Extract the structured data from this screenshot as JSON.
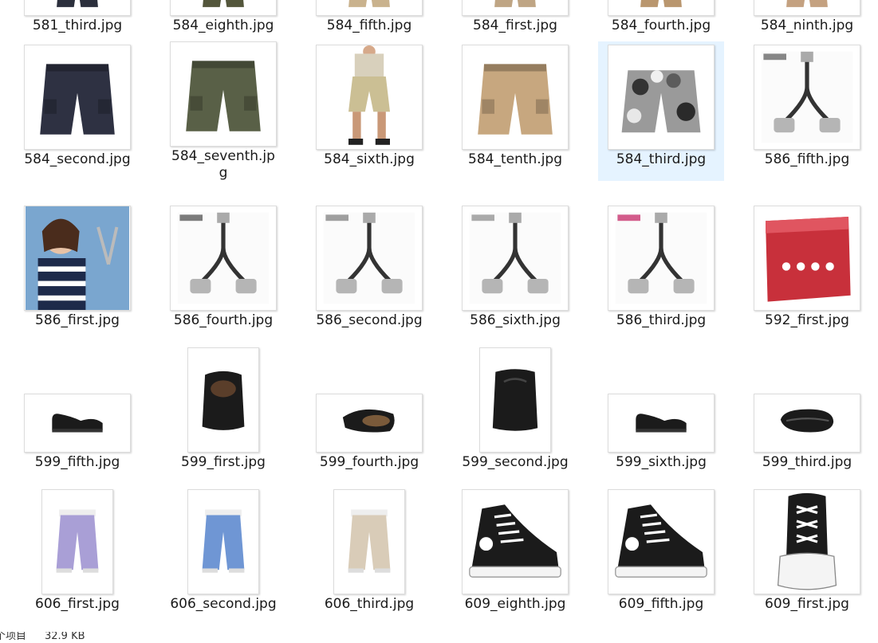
{
  "window": {
    "status_items": "个项目",
    "status_size": "32.9 KB"
  },
  "rows": [
    [
      {
        "name": "581_third.jpg",
        "thumb": "shorts",
        "color": "#2b2f3c",
        "fit": "wide"
      },
      {
        "name": "584_eighth.jpg",
        "thumb": "shorts",
        "color": "#53563b",
        "fit": "wide"
      },
      {
        "name": "584_fifth.jpg",
        "thumb": "shorts",
        "color": "#c9b28d",
        "fit": "wide"
      },
      {
        "name": "584_first.jpg",
        "thumb": "shorts",
        "color": "#bfa584",
        "fit": "wide"
      },
      {
        "name": "584_fourth.jpg",
        "thumb": "shorts",
        "color": "#b9966e",
        "fit": "wide"
      },
      {
        "name": "584_ninth.jpg",
        "thumb": "shorts",
        "color": "#c4a180",
        "fit": "wide"
      }
    ],
    [
      {
        "name": "584_second.jpg",
        "thumb": "shorts",
        "color": "#2e3142",
        "fit": "square"
      },
      {
        "name": "584_seventh.jpg",
        "thumb": "shorts",
        "color": "#596047",
        "fit": "square"
      },
      {
        "name": "584_sixth.jpg",
        "thumb": "person-shorts",
        "color": "#cbbf94",
        "fit": "square"
      },
      {
        "name": "584_tenth.jpg",
        "thumb": "shorts",
        "color": "#c7a77f",
        "fit": "square"
      },
      {
        "name": "584_third.jpg",
        "thumb": "camo-shorts",
        "color": "#6a6a6a",
        "fit": "square",
        "selected": true
      },
      {
        "name": "586_fifth.jpg",
        "thumb": "adapter",
        "color": "#555555",
        "fit": "square"
      }
    ],
    [
      {
        "name": "586_first.jpg",
        "thumb": "woman",
        "color": "#3a6fa8",
        "fit": "square"
      },
      {
        "name": "586_fourth.jpg",
        "thumb": "adapter",
        "color": "#444444",
        "fit": "square"
      },
      {
        "name": "586_second.jpg",
        "thumb": "adapter",
        "color": "#777777",
        "fit": "square"
      },
      {
        "name": "586_sixth.jpg",
        "thumb": "adapter",
        "color": "#888888",
        "fit": "square"
      },
      {
        "name": "586_third.jpg",
        "thumb": "adapter",
        "color": "#c2185b",
        "fit": "square"
      },
      {
        "name": "592_first.jpg",
        "thumb": "redbox",
        "color": "#c8303b",
        "fit": "square"
      }
    ],
    [
      {
        "name": "599_fifth.jpg",
        "thumb": "shoe-side",
        "color": "#1b1b1b",
        "fit": "wide"
      },
      {
        "name": "599_first.jpg",
        "thumb": "shoe-front",
        "color": "#1b1b1b",
        "fit": "tall"
      },
      {
        "name": "599_fourth.jpg",
        "thumb": "shoe-top",
        "color": "#1b1b1b",
        "fit": "wide"
      },
      {
        "name": "599_second.jpg",
        "thumb": "shoe-back",
        "color": "#1b1b1b",
        "fit": "tall"
      },
      {
        "name": "599_sixth.jpg",
        "thumb": "shoe-side",
        "color": "#1b1b1b",
        "fit": "wide"
      },
      {
        "name": "599_third.jpg",
        "thumb": "shoe-sole",
        "color": "#1b1b1b",
        "fit": "wide"
      }
    ],
    [
      {
        "name": "606_first.jpg",
        "thumb": "pants",
        "color": "#a99fd6",
        "fit": "tall"
      },
      {
        "name": "606_second.jpg",
        "thumb": "pants",
        "color": "#6f96d4",
        "fit": "tall"
      },
      {
        "name": "606_third.jpg",
        "thumb": "pants",
        "color": "#d9ccb8",
        "fit": "tall"
      },
      {
        "name": "609_eighth.jpg",
        "thumb": "sneaker",
        "color": "#1b1b1b",
        "fit": "square"
      },
      {
        "name": "609_fifth.jpg",
        "thumb": "sneaker",
        "color": "#1b1b1b",
        "fit": "square"
      },
      {
        "name": "609_first.jpg",
        "thumb": "sneaker-front",
        "color": "#1b1b1b",
        "fit": "square"
      }
    ]
  ]
}
